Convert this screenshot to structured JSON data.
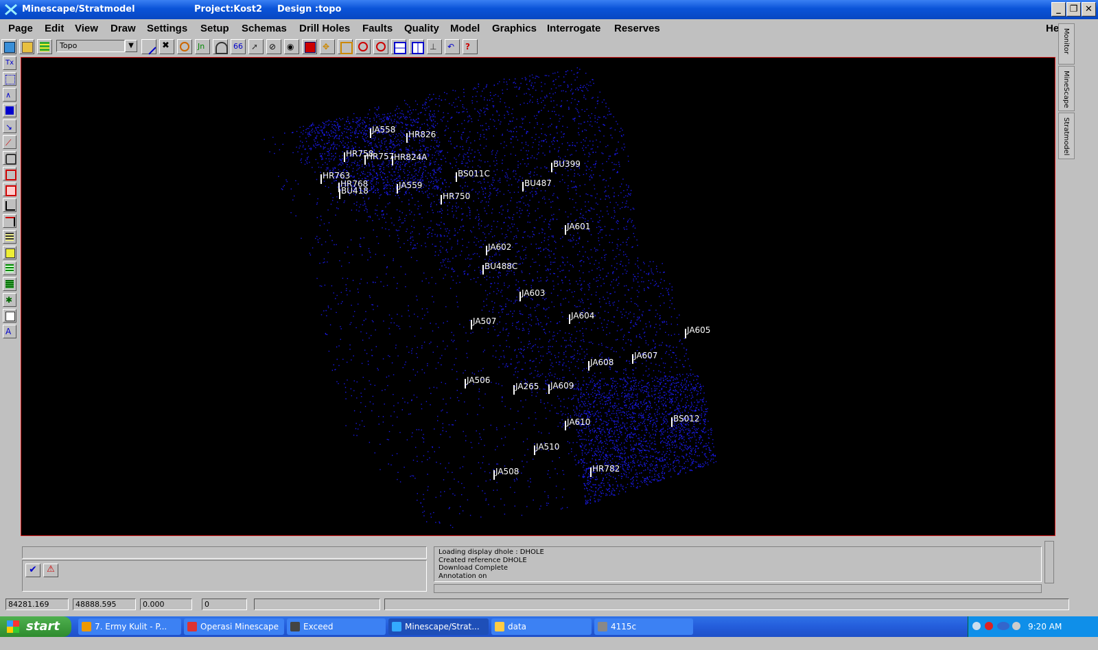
{
  "window": {
    "app_title": "Minescape/Stratmodel",
    "project": "Project:Kost2",
    "design": "Design :topo",
    "controls": [
      "_",
      "❐",
      "✕"
    ]
  },
  "menu": [
    "Page",
    "Edit",
    "View",
    "Draw",
    "Settings",
    "Setup",
    "Schemas",
    "Drill Holes",
    "Faults",
    "Quality",
    "Model",
    "Graphics",
    "Interrogate",
    "Reserves"
  ],
  "help_label": "Help",
  "toolbar": {
    "layer_value": "Topo"
  },
  "side_tabs": [
    "Monitor",
    "MineScape",
    "Stratmodel"
  ],
  "drillholes": [
    "JA558",
    "HR826",
    "HR758",
    "HR757",
    "HR824A",
    "HR763",
    "HR768",
    "BU418",
    "JA559",
    "BS011C",
    "HR750",
    "BU399",
    "BU487",
    "JA601",
    "JA602",
    "BU488C",
    "JA603",
    "JA604",
    "JA507",
    "JA605",
    "JA608",
    "JA607",
    "JA506",
    "JA265",
    "JA609",
    "BS012",
    "JA610",
    "JA510",
    "HR782",
    "JA508"
  ],
  "messages": [
    "Loading display dhole : DHOLE",
    "Created reference DHOLE",
    "Download Complete",
    "Annotation on"
  ],
  "status": {
    "x": "84281.169",
    "y": "48888.595",
    "z": "0.000",
    "count": "0",
    "extra": ""
  },
  "taskbar": {
    "start": "start",
    "tasks": [
      "7. Ermy Kulit - P...",
      "Operasi Minescape",
      "Exceed",
      "Minescape/Strat...",
      "data",
      "4115c"
    ],
    "clock": "9:20 AM"
  },
  "colors": {
    "points": "#1a1aee",
    "canvas": "#000000",
    "canvas_border": "#e02020",
    "titlebar": "#0a53d8"
  }
}
